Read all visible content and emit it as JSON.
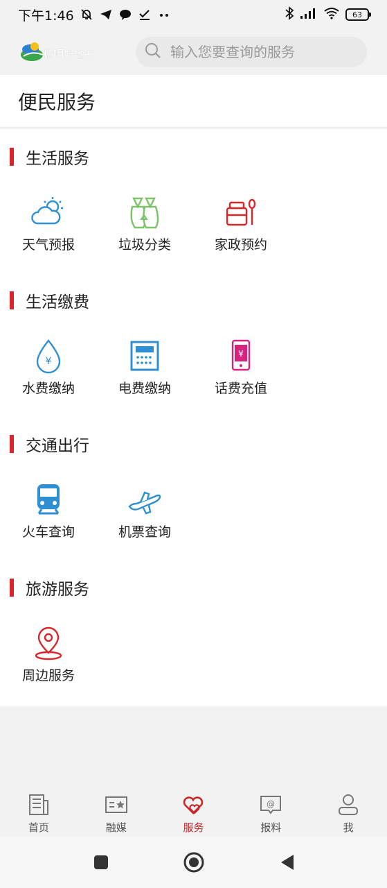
{
  "status_bar": {
    "time": "下午1:46",
    "battery": "63"
  },
  "header": {
    "logo_text": "精明好地方",
    "search_placeholder": "输入您要查询的服务"
  },
  "page": {
    "title": "便民服务"
  },
  "sections": [
    {
      "title": "生活服务",
      "items": [
        {
          "label": "天气预报",
          "icon": "weather-icon"
        },
        {
          "label": "垃圾分类",
          "icon": "garbage-sorting-icon"
        },
        {
          "label": "家政预约",
          "icon": "housekeeping-icon"
        }
      ]
    },
    {
      "title": "生活缴费",
      "items": [
        {
          "label": "水费缴纳",
          "icon": "water-drop-icon"
        },
        {
          "label": "电费缴纳",
          "icon": "electric-meter-icon"
        },
        {
          "label": "话费充值",
          "icon": "phone-recharge-icon"
        }
      ]
    },
    {
      "title": "交通出行",
      "items": [
        {
          "label": "火车查询",
          "icon": "train-icon"
        },
        {
          "label": "机票查询",
          "icon": "airplane-icon"
        }
      ]
    },
    {
      "title": "旅游服务",
      "items": [
        {
          "label": "周边服务",
          "icon": "location-pin-icon"
        }
      ]
    }
  ],
  "bottom_nav": [
    {
      "label": "首页",
      "icon": "news-icon",
      "active": false
    },
    {
      "label": "融媒",
      "icon": "media-icon",
      "active": false
    },
    {
      "label": "服务",
      "icon": "heart-service-icon",
      "active": true
    },
    {
      "label": "报料",
      "icon": "report-icon",
      "active": false
    },
    {
      "label": "我",
      "icon": "user-icon",
      "active": false
    }
  ],
  "colors": {
    "accent": "#d8262b",
    "active_nav": "#c9252b",
    "blue": "#2f8fd3",
    "green": "#7cc36a",
    "magenta": "#d6237f"
  }
}
